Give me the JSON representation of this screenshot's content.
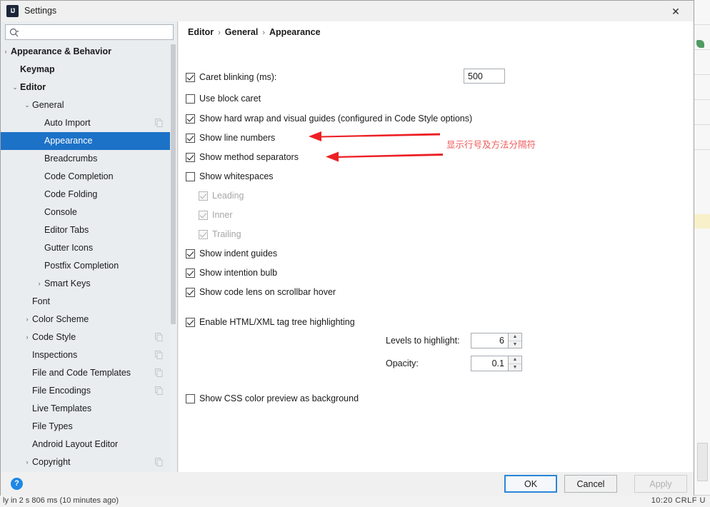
{
  "window": {
    "title": "Settings",
    "logo_text": "IJ",
    "close_label": "✕"
  },
  "search": {
    "value": "",
    "placeholder": ""
  },
  "sidebar": {
    "items": [
      {
        "label": "Appearance & Behavior",
        "indent": 14,
        "twisty": "›",
        "bold": true,
        "selected": false,
        "copy": false
      },
      {
        "label": "Keymap",
        "indent": 27,
        "twisty": "",
        "bold": true,
        "selected": false,
        "copy": false
      },
      {
        "label": "Editor",
        "indent": 27,
        "twisty": "⌄",
        "bold": true,
        "selected": false,
        "copy": false
      },
      {
        "label": "General",
        "indent": 44,
        "twisty": "⌄",
        "bold": false,
        "selected": false,
        "copy": false
      },
      {
        "label": "Auto Import",
        "indent": 61,
        "twisty": "",
        "bold": false,
        "selected": false,
        "copy": true
      },
      {
        "label": "Appearance",
        "indent": 61,
        "twisty": "",
        "bold": false,
        "selected": true,
        "copy": false
      },
      {
        "label": "Breadcrumbs",
        "indent": 61,
        "twisty": "",
        "bold": false,
        "selected": false,
        "copy": false
      },
      {
        "label": "Code Completion",
        "indent": 61,
        "twisty": "",
        "bold": false,
        "selected": false,
        "copy": false
      },
      {
        "label": "Code Folding",
        "indent": 61,
        "twisty": "",
        "bold": false,
        "selected": false,
        "copy": false
      },
      {
        "label": "Console",
        "indent": 61,
        "twisty": "",
        "bold": false,
        "selected": false,
        "copy": false
      },
      {
        "label": "Editor Tabs",
        "indent": 61,
        "twisty": "",
        "bold": false,
        "selected": false,
        "copy": false
      },
      {
        "label": "Gutter Icons",
        "indent": 61,
        "twisty": "",
        "bold": false,
        "selected": false,
        "copy": false
      },
      {
        "label": "Postfix Completion",
        "indent": 61,
        "twisty": "",
        "bold": false,
        "selected": false,
        "copy": false
      },
      {
        "label": "Smart Keys",
        "indent": 61,
        "twisty": "›",
        "bold": false,
        "selected": false,
        "copy": false
      },
      {
        "label": "Font",
        "indent": 44,
        "twisty": "",
        "bold": false,
        "selected": false,
        "copy": false
      },
      {
        "label": "Color Scheme",
        "indent": 44,
        "twisty": "›",
        "bold": false,
        "selected": false,
        "copy": false
      },
      {
        "label": "Code Style",
        "indent": 44,
        "twisty": "›",
        "bold": false,
        "selected": false,
        "copy": true
      },
      {
        "label": "Inspections",
        "indent": 44,
        "twisty": "",
        "bold": false,
        "selected": false,
        "copy": true
      },
      {
        "label": "File and Code Templates",
        "indent": 44,
        "twisty": "",
        "bold": false,
        "selected": false,
        "copy": true
      },
      {
        "label": "File Encodings",
        "indent": 44,
        "twisty": "",
        "bold": false,
        "selected": false,
        "copy": true
      },
      {
        "label": "Live Templates",
        "indent": 44,
        "twisty": "",
        "bold": false,
        "selected": false,
        "copy": false
      },
      {
        "label": "File Types",
        "indent": 44,
        "twisty": "",
        "bold": false,
        "selected": false,
        "copy": false
      },
      {
        "label": "Android Layout Editor",
        "indent": 44,
        "twisty": "",
        "bold": false,
        "selected": false,
        "copy": false
      },
      {
        "label": "Copyright",
        "indent": 44,
        "twisty": "›",
        "bold": false,
        "selected": false,
        "copy": true
      }
    ]
  },
  "breadcrumb": {
    "crumbs": [
      "Editor",
      "General",
      "Appearance"
    ],
    "separator": "›"
  },
  "options": [
    {
      "label": "Caret blinking (ms):",
      "checked": true,
      "disabled": false,
      "indent": 0,
      "has_input": true
    },
    {
      "label": "Use block caret",
      "checked": false,
      "disabled": false,
      "indent": 0,
      "has_input": false
    },
    {
      "label": "Show hard wrap and visual guides (configured in Code Style options)",
      "checked": true,
      "disabled": false,
      "indent": 0,
      "has_input": false
    },
    {
      "label": "Show line numbers",
      "checked": true,
      "disabled": false,
      "indent": 0,
      "has_input": false
    },
    {
      "label": "Show method separators",
      "checked": true,
      "disabled": false,
      "indent": 0,
      "has_input": false
    },
    {
      "label": "Show whitespaces",
      "checked": false,
      "disabled": false,
      "indent": 0,
      "has_input": false
    },
    {
      "label": "Leading",
      "checked": true,
      "disabled": true,
      "indent": 18,
      "has_input": false
    },
    {
      "label": "Inner",
      "checked": true,
      "disabled": true,
      "indent": 18,
      "has_input": false
    },
    {
      "label": "Trailing",
      "checked": true,
      "disabled": true,
      "indent": 18,
      "has_input": false
    },
    {
      "label": "Show indent guides",
      "checked": true,
      "disabled": false,
      "indent": 0,
      "has_input": false
    },
    {
      "label": "Show intention bulb",
      "checked": true,
      "disabled": false,
      "indent": 0,
      "has_input": false
    },
    {
      "label": "Show code lens on scrollbar hover",
      "checked": true,
      "disabled": false,
      "indent": 0,
      "has_input": false
    },
    {
      "label": "Enable HTML/XML tag tree highlighting",
      "checked": true,
      "disabled": false,
      "indent": 0,
      "has_input": false
    },
    {
      "label": "Show CSS color preview as background",
      "checked": false,
      "disabled": false,
      "indent": 0,
      "has_input": false
    }
  ],
  "caret_blinking": {
    "value": "500"
  },
  "levels_to_highlight": {
    "label": "Levels to highlight:",
    "value": "6"
  },
  "opacity": {
    "label": "Opacity:",
    "value": "0.1"
  },
  "annotation": {
    "text": "显示行号及方法分隔符",
    "color": "#f05a5a",
    "arrow_count": 2
  },
  "footer": {
    "help_label": "?",
    "ok_label": "OK",
    "cancel_label": "Cancel",
    "apply_label": "Apply"
  },
  "ide_status": {
    "left": "ly in 2 s 806 ms (10 minutes ago)",
    "right": "10:20   CRLF   U"
  }
}
